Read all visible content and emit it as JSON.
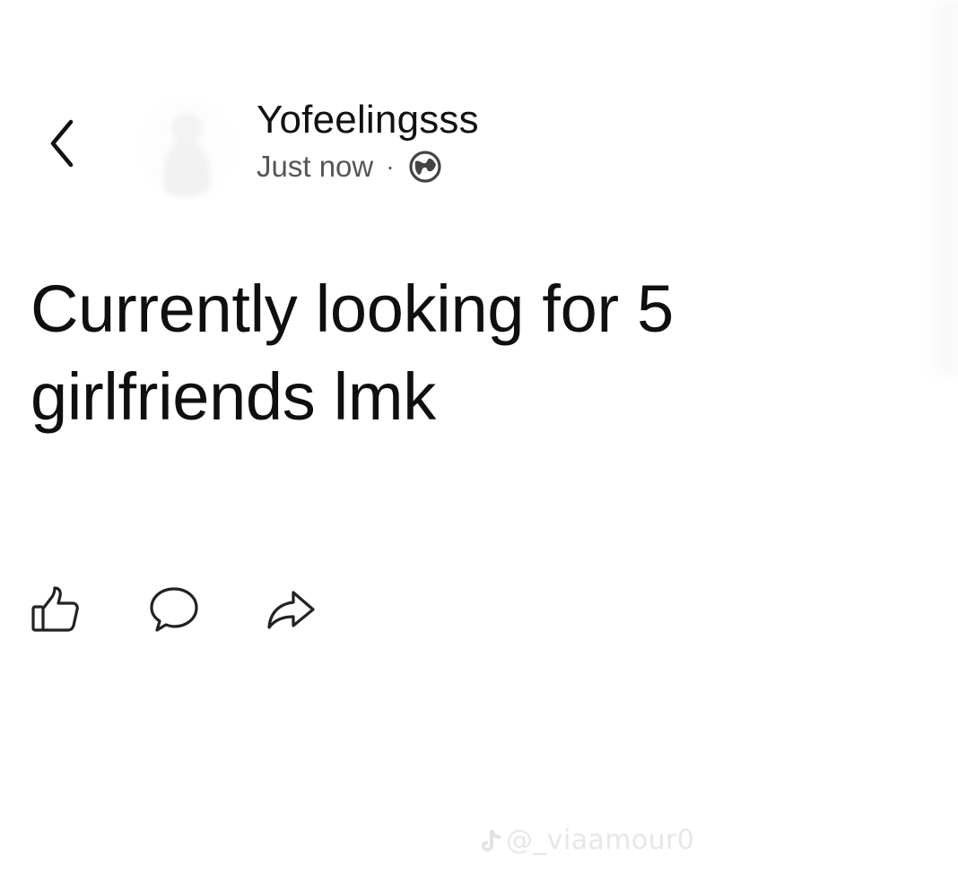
{
  "header": {
    "back_icon": "chevron-left-icon",
    "username": "Yofeelingsss",
    "timestamp": "Just now",
    "separator": "·",
    "privacy_icon": "globe-icon"
  },
  "post": {
    "text": "Currently looking for 5 girlfriends lmk"
  },
  "actions": {
    "like_icon": "thumbs-up-icon",
    "comment_icon": "comment-bubble-icon",
    "share_icon": "share-arrow-icon"
  },
  "watermark": {
    "icon": "tiktok-icon",
    "text": "@_viaamour0"
  },
  "colors": {
    "background": "#ffffff",
    "primary_text": "#111111",
    "secondary_text": "#555555",
    "watermark": "#e7e7e7"
  }
}
